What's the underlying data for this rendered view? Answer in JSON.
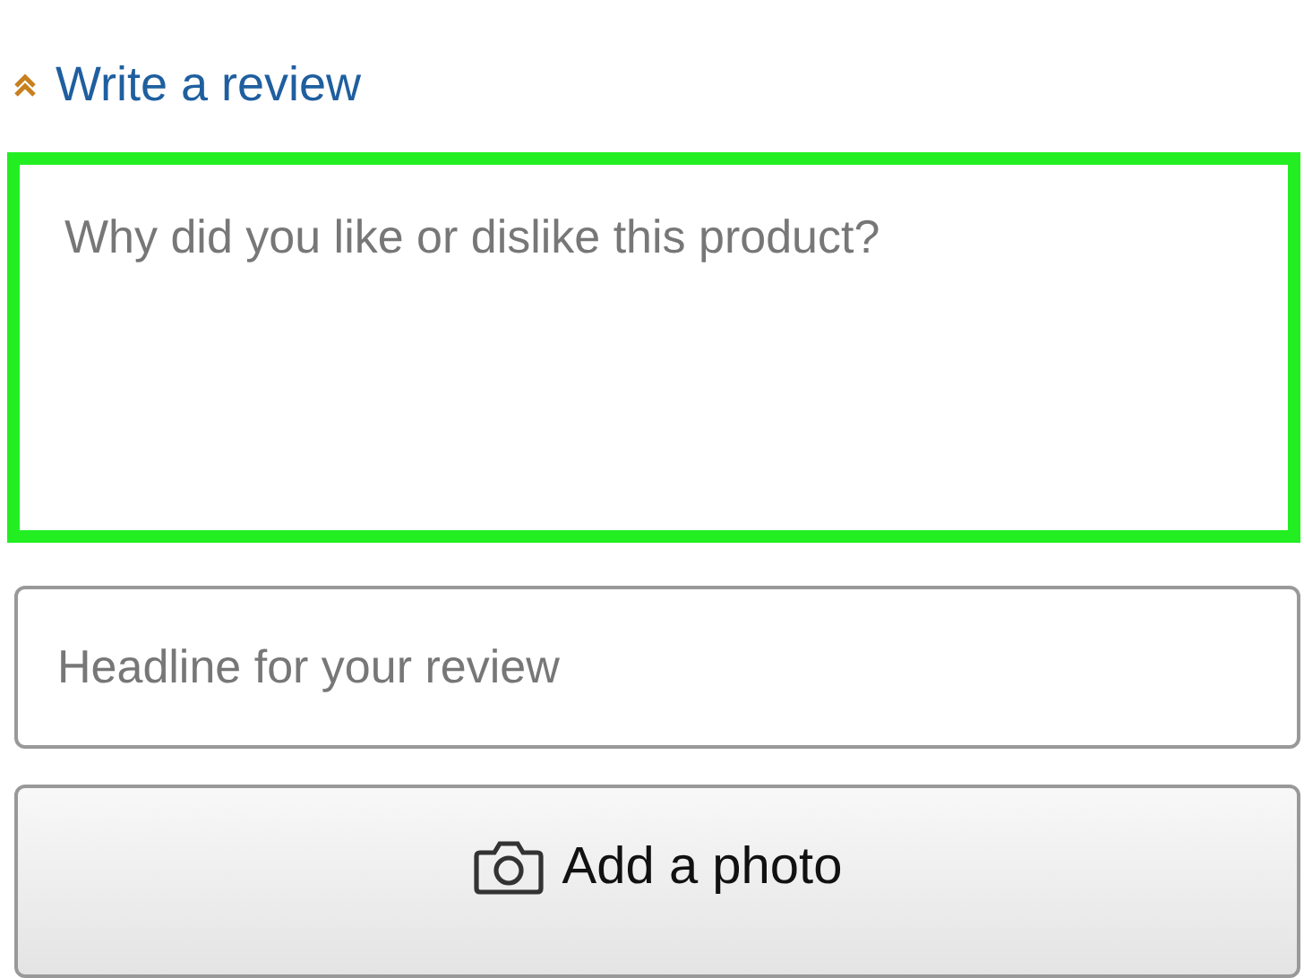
{
  "write_review": {
    "label": "Write a review"
  },
  "review_text": {
    "placeholder": "Why did you like or dislike this product?",
    "highlighted": true
  },
  "headline": {
    "placeholder": "Headline for your review"
  },
  "add_photo": {
    "label": "Add a photo"
  }
}
